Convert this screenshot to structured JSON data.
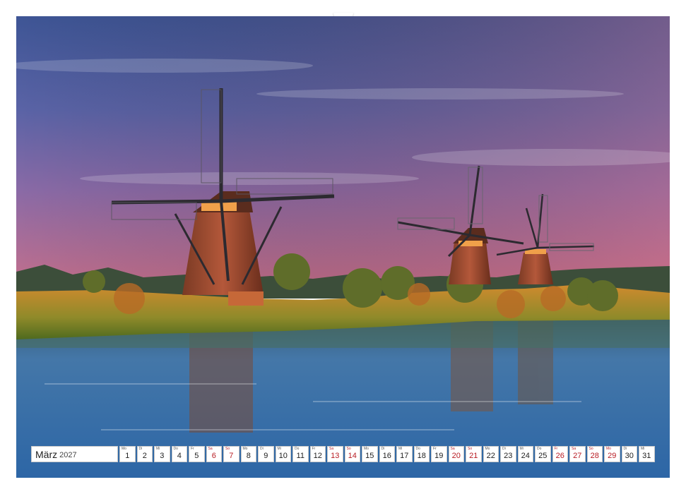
{
  "calendar": {
    "month": "März",
    "year": "2027",
    "days": [
      {
        "num": "1",
        "dn": "Mo",
        "weekend": false
      },
      {
        "num": "2",
        "dn": "Di",
        "weekend": false
      },
      {
        "num": "3",
        "dn": "Mi",
        "weekend": false
      },
      {
        "num": "4",
        "dn": "Do",
        "weekend": false
      },
      {
        "num": "5",
        "dn": "Fr",
        "weekend": false
      },
      {
        "num": "6",
        "dn": "Sa",
        "weekend": true
      },
      {
        "num": "7",
        "dn": "So",
        "weekend": true
      },
      {
        "num": "8",
        "dn": "Mo",
        "weekend": false
      },
      {
        "num": "9",
        "dn": "Di",
        "weekend": false
      },
      {
        "num": "10",
        "dn": "Mi",
        "weekend": false
      },
      {
        "num": "11",
        "dn": "Do",
        "weekend": false
      },
      {
        "num": "12",
        "dn": "Fr",
        "weekend": false
      },
      {
        "num": "13",
        "dn": "Sa",
        "weekend": true
      },
      {
        "num": "14",
        "dn": "So",
        "weekend": true
      },
      {
        "num": "15",
        "dn": "Mo",
        "weekend": false
      },
      {
        "num": "16",
        "dn": "Di",
        "weekend": false
      },
      {
        "num": "17",
        "dn": "Mi",
        "weekend": false
      },
      {
        "num": "18",
        "dn": "Do",
        "weekend": false
      },
      {
        "num": "19",
        "dn": "Fr",
        "weekend": false
      },
      {
        "num": "20",
        "dn": "Sa",
        "weekend": true
      },
      {
        "num": "21",
        "dn": "So",
        "weekend": true
      },
      {
        "num": "22",
        "dn": "Mo",
        "weekend": false
      },
      {
        "num": "23",
        "dn": "Di",
        "weekend": false
      },
      {
        "num": "24",
        "dn": "Mi",
        "weekend": false
      },
      {
        "num": "25",
        "dn": "Do",
        "weekend": false
      },
      {
        "num": "26",
        "dn": "Fr",
        "weekend": true
      },
      {
        "num": "27",
        "dn": "Sa",
        "weekend": true
      },
      {
        "num": "28",
        "dn": "So",
        "weekend": true
      },
      {
        "num": "29",
        "dn": "Mo",
        "weekend": true
      },
      {
        "num": "30",
        "dn": "Di",
        "weekend": false
      },
      {
        "num": "31",
        "dn": "Mi",
        "weekend": false
      }
    ]
  },
  "colors": {
    "weekend": "#b81d24",
    "sky_top": "#4a5e9c",
    "sky_bottom": "#c86c86",
    "water": "#3f74ad"
  }
}
